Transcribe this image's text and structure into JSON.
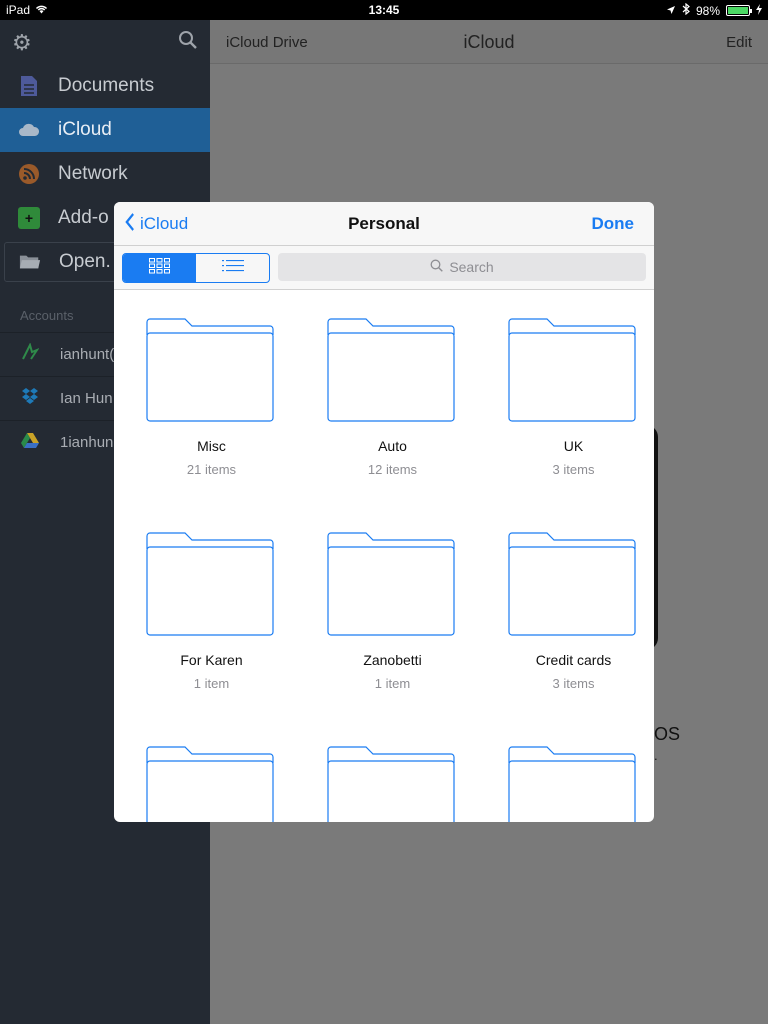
{
  "status_bar": {
    "device": "iPad",
    "time": "13:45",
    "battery": "98%",
    "battery_level": 0.98
  },
  "sidebar": {
    "items": [
      {
        "label": "Documents",
        "icon": "document-icon"
      },
      {
        "label": "iCloud",
        "icon": "cloud-icon",
        "active": true
      },
      {
        "label": "Network",
        "icon": "wifi-icon"
      },
      {
        "label": "Add-o",
        "icon": "plus-icon"
      },
      {
        "label": "Open.",
        "icon": "folder-icon"
      }
    ],
    "accounts_label": "Accounts",
    "accounts": [
      {
        "label": "ianhunt(",
        "icon": "cloudapp-icon"
      },
      {
        "label": "Ian Hun",
        "icon": "dropbox-icon"
      },
      {
        "label": "1ianhun",
        "icon": "google-drive-icon"
      }
    ]
  },
  "main": {
    "back_label": "iCloud Drive",
    "title": "iCloud",
    "edit_label": "Edit",
    "bg_text_1": "OS",
    "bg_text_2": "."
  },
  "modal": {
    "back_label": "iCloud",
    "title": "Personal",
    "done_label": "Done",
    "search_placeholder": "Search",
    "view_mode": "grid",
    "folders": [
      {
        "name": "Misc",
        "count": "21 items"
      },
      {
        "name": "Auto",
        "count": "12 items"
      },
      {
        "name": "UK",
        "count": "3 items"
      },
      {
        "name": "For Karen",
        "count": "1 item"
      },
      {
        "name": "Zanobetti",
        "count": "1 item"
      },
      {
        "name": "Credit cards",
        "count": "3 items"
      },
      {
        "name": "",
        "count": ""
      },
      {
        "name": "",
        "count": ""
      },
      {
        "name": "",
        "count": ""
      }
    ]
  },
  "colors": {
    "accent": "#1a7cf2",
    "sidebar_bg": "#242a33",
    "sidebar_active": "#1f5f96"
  }
}
